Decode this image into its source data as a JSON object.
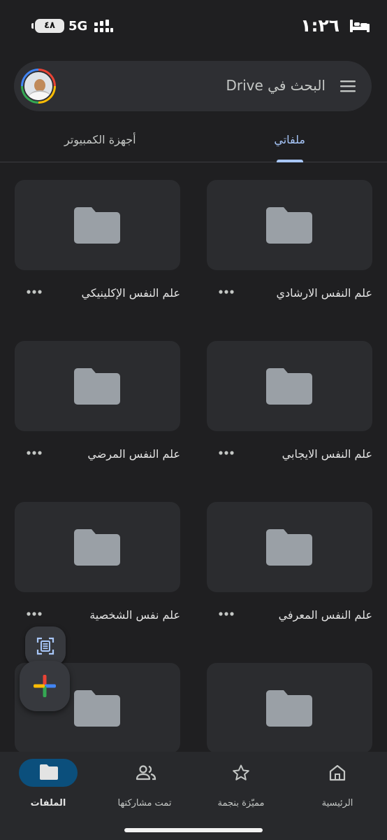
{
  "status_bar": {
    "time": "١:٢٦",
    "network": "5G",
    "battery": "٤٨"
  },
  "search": {
    "label": "البحث في Drive"
  },
  "tabs": [
    {
      "label": "ملفاتي",
      "active": true
    },
    {
      "label": "أجهزة الكمبيوتر",
      "active": false
    }
  ],
  "folders": [
    {
      "name": "علم النفس الارشادي"
    },
    {
      "name": "علم النفس الإكلينيكي"
    },
    {
      "name": "علم النفس الايجابي"
    },
    {
      "name": "علم النفس المرضي"
    },
    {
      "name": "علم النفس المعرفي"
    },
    {
      "name": "علم نفس الشخصية"
    },
    {
      "name": ""
    },
    {
      "name": ""
    }
  ],
  "bottom_nav": [
    {
      "label": "الرئيسية",
      "icon": "home-icon",
      "active": false
    },
    {
      "label": "مميّزة بنجمة",
      "icon": "star-icon",
      "active": false
    },
    {
      "label": "تمت مشاركتها",
      "icon": "people-icon",
      "active": false
    },
    {
      "label": "الملفات",
      "icon": "folder-icon",
      "active": true
    }
  ],
  "colors": {
    "background": "#1f1f21",
    "accent": "#a8c7fa",
    "active_pill": "#0b4f7c",
    "folder": "#9aa0a6"
  }
}
